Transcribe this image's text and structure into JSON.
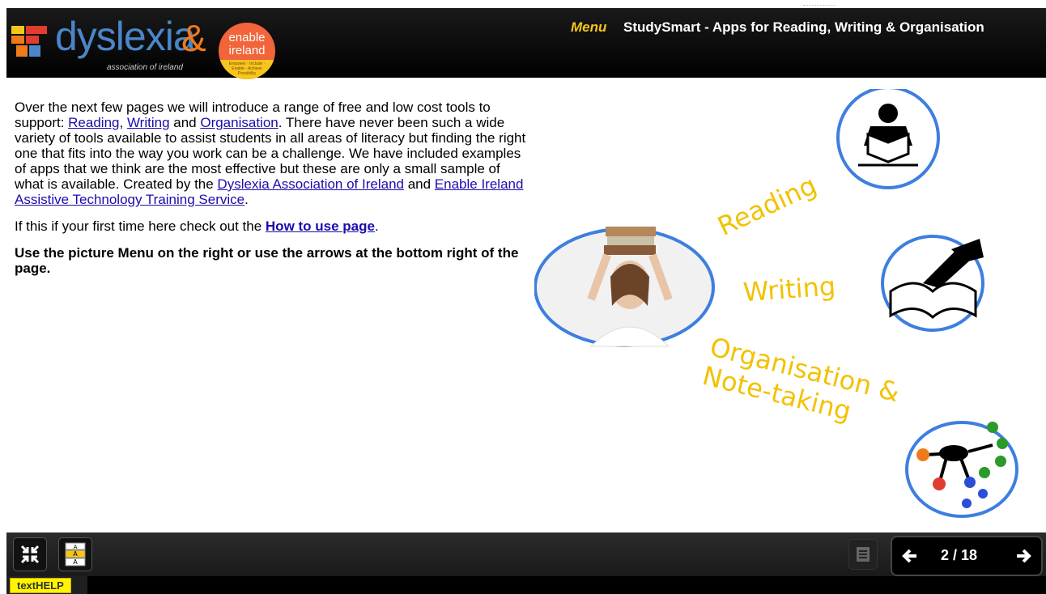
{
  "header": {
    "logo_text": "dyslexia",
    "logo_subtitle": "association of ireland",
    "logo_ampersand": "&",
    "enable_line1": "enable",
    "enable_line2": "ireland",
    "enable_tagline": "Empower · Include · Enable · Achieve Possibility",
    "menu_label": "Menu",
    "title": "StudySmart - Apps for Reading, Writing & Organisation"
  },
  "content": {
    "p1_a": "Over the next few pages we will introduce a range of free and low cost tools to support: ",
    "link_reading": "Reading",
    "p1_comma": ", ",
    "link_writing": "Writing",
    "p1_and": " and ",
    "link_organisation": "Organisation",
    "p1_b": ". There have never been such a wide variety of tools available to assist students in all areas of literacy but finding the right one that fits into the way you work can be a challenge. We have included examples of apps that we think are the most effective but these are only a small sample of what is available. Created by the ",
    "link_dai": "Dyslexia Association of Ireland",
    "p1_and2": " and ",
    "link_enable": "Enable Ireland Assistive Technology Training Service",
    "p1_end": ".",
    "p2_a": "If this if your first time here check out the ",
    "link_howto": "How to use page",
    "p2_end": ".",
    "p3": "Use the picture Menu on the right or use the arrows at the bottom right of the page."
  },
  "picture_menu": {
    "reading_label": "Reading",
    "writing_label": "Writing",
    "organisation_label": "Organisation &",
    "notetaking_label": "Note-taking"
  },
  "footer": {
    "page_counter": "2 / 18",
    "textHELP_label": "textHELP"
  },
  "colors": {
    "accent_menu": "#f5c518",
    "circle_blue": "#3d7fe0",
    "label_yellow": "#f2c200"
  }
}
